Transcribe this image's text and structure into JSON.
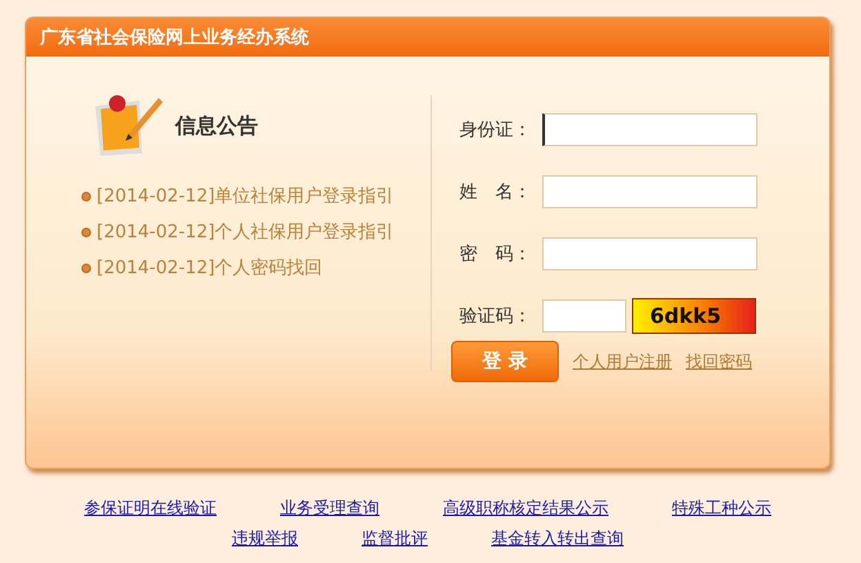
{
  "window": {
    "title": "广东省社会保险网上业务经办系统"
  },
  "notice": {
    "title": "信息公告",
    "items": [
      {
        "text": "[2014-02-12]单位社保用户登录指引"
      },
      {
        "text": "[2014-02-12]个人社保用户登录指引"
      },
      {
        "text": "[2014-02-12]个人密码找回"
      }
    ]
  },
  "login": {
    "fields": [
      {
        "kind": "text",
        "label": "身份证：",
        "focused": true
      },
      {
        "kind": "text",
        "label": "姓　名：",
        "focused": false
      },
      {
        "kind": "password",
        "label": "密　码：",
        "focused": false
      },
      {
        "kind": "captcha",
        "label": "验证码：",
        "focused": false,
        "captcha": "6dkk5"
      }
    ],
    "button": "登 录",
    "links": [
      "个人用户注册",
      "找回密码"
    ]
  },
  "footer_links": [
    [
      "参保证明在线验证",
      "业务受理查询",
      "高级职称核定结果公示",
      "特殊工种公示"
    ],
    [
      "违规举报",
      "监督批评",
      "基金转入转出查询"
    ]
  ]
}
